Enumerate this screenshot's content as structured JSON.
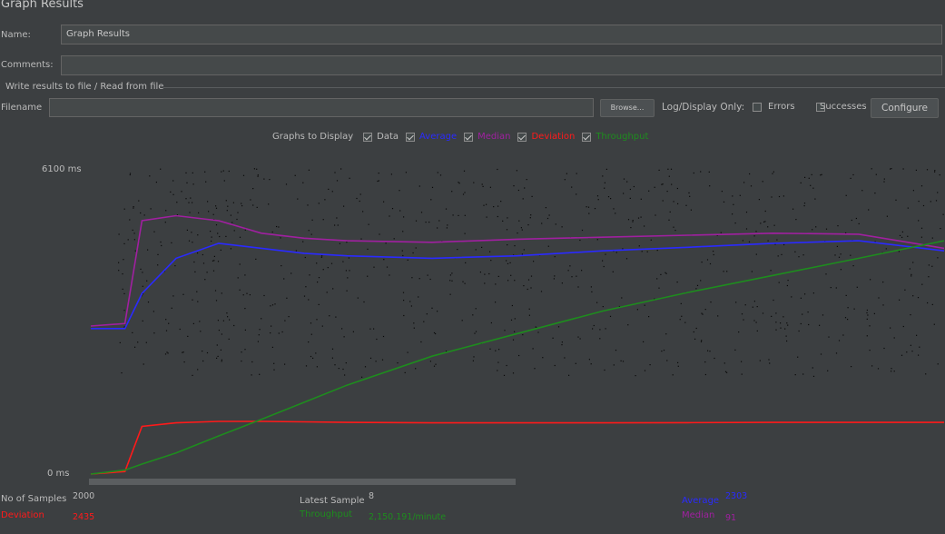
{
  "panel": {
    "title": "Graph Results"
  },
  "name_field": {
    "label": "Name:",
    "value": "Graph Results"
  },
  "comments_field": {
    "label": "Comments:",
    "value": ""
  },
  "file_group": {
    "legend": "Write results to file / Read from file",
    "filename_label": "Filename",
    "filename_value": "",
    "browse_label": "Browse...",
    "log_display_label": "Log/Display Only:",
    "errors_label": "Errors",
    "errors_checked": false,
    "successes_label": "Successes",
    "successes_checked": false,
    "configure_label": "Configure"
  },
  "graphs_to_display": {
    "label": "Graphs to Display",
    "items": [
      {
        "label": "Data",
        "checked": true,
        "color": "#c8c8c8"
      },
      {
        "label": "Average",
        "checked": true,
        "color": "#2a2aff"
      },
      {
        "label": "Median",
        "checked": true,
        "color": "#a020a0"
      },
      {
        "label": "Deviation",
        "checked": true,
        "color": "#ff1a1a"
      },
      {
        "label": "Throughput",
        "checked": true,
        "color": "#1e8c1e"
      }
    ]
  },
  "chart_data": {
    "type": "line",
    "ylim": [
      0,
      6100
    ],
    "y_top_label": "6100  ms",
    "y_bottom_label": "0  ms",
    "x": [
      0,
      4,
      6,
      10,
      15,
      20,
      25,
      30,
      40,
      50,
      60,
      70,
      80,
      90,
      100
    ],
    "series": [
      {
        "name": "Average",
        "color": "#2a2aff",
        "values": [
          2900,
          2900,
          3600,
          4300,
          4600,
          4500,
          4400,
          4350,
          4300,
          4350,
          4450,
          4520,
          4600,
          4650,
          4450
        ]
      },
      {
        "name": "Median",
        "color": "#a020a0",
        "values": [
          2950,
          3000,
          5050,
          5150,
          5050,
          4800,
          4700,
          4650,
          4620,
          4680,
          4720,
          4760,
          4800,
          4780,
          4500
        ]
      },
      {
        "name": "Deviation",
        "color": "#ff1a1a",
        "values": [
          0,
          50,
          950,
          1020,
          1050,
          1050,
          1040,
          1030,
          1020,
          1020,
          1020,
          1025,
          1030,
          1030,
          1030
        ]
      },
      {
        "name": "Throughput",
        "color": "#1e8c1e",
        "values": [
          0,
          80,
          200,
          420,
          760,
          1090,
          1430,
          1770,
          2350,
          2800,
          3250,
          3620,
          3960,
          4300,
          4650
        ]
      }
    ]
  },
  "stats": {
    "samples_label": "No of Samples",
    "samples_value": "2000",
    "latest_label": "Latest Sample",
    "latest_value": "8",
    "average_label": "Average",
    "average_value": "2303",
    "deviation_label": "Deviation",
    "deviation_value": "2435",
    "throughput_label": "Throughput",
    "throughput_value": "2,150.191/minute",
    "median_label": "Median",
    "median_value": "91"
  }
}
